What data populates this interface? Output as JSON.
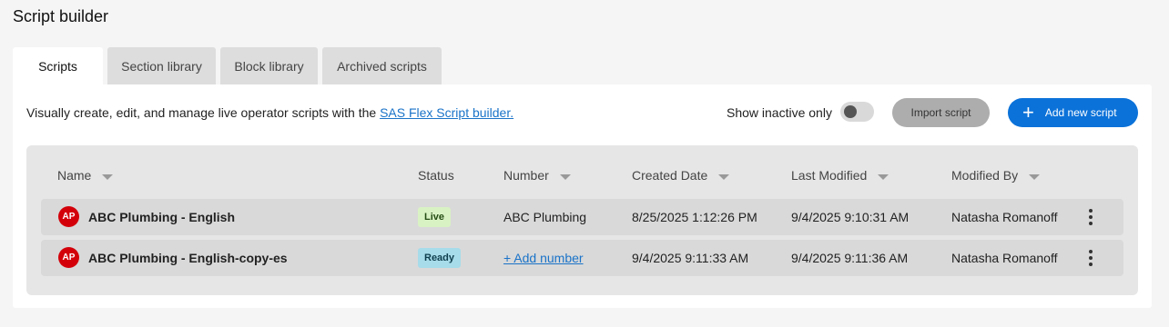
{
  "page": {
    "title": "Script builder"
  },
  "tabs": [
    {
      "label": "Scripts",
      "active": true
    },
    {
      "label": "Section library",
      "active": false
    },
    {
      "label": "Block library",
      "active": false
    },
    {
      "label": "Archived scripts",
      "active": false
    }
  ],
  "toolbar": {
    "description": "Visually create, edit, and manage live operator scripts with the ",
    "link_text": "SAS Flex Script builder.",
    "toggle_label": "Show inactive only",
    "toggle_on": false,
    "import_label": "Import script",
    "add_label": "Add new script"
  },
  "table": {
    "columns": {
      "name": "Name",
      "status": "Status",
      "number": "Number",
      "created": "Created Date",
      "modified": "Last Modified",
      "modified_by": "Modified By"
    },
    "rows": [
      {
        "avatar": "AP",
        "name": "ABC Plumbing - English",
        "status": "Live",
        "number": "ABC Plumbing",
        "created": "8/25/2025 1:12:26 PM",
        "modified": "9/4/2025 9:10:31 AM",
        "modified_by": "Natasha Romanoff"
      },
      {
        "avatar": "AP",
        "name": "ABC Plumbing - English-copy-es",
        "status": "Ready",
        "number": "+ Add number",
        "created": "9/4/2025 9:11:33 AM",
        "modified": "9/4/2025 9:11:36 AM",
        "modified_by": "Natasha Romanoff"
      }
    ]
  },
  "colors": {
    "accent": "#0b72d9",
    "avatar": "#d3000a",
    "live_badge": "#d9f2c4",
    "ready_badge": "#a7dcea"
  },
  "icons": {
    "add": "plus-icon",
    "row_menu": "kebab-menu-icon",
    "sort": "caret-down-icon"
  }
}
